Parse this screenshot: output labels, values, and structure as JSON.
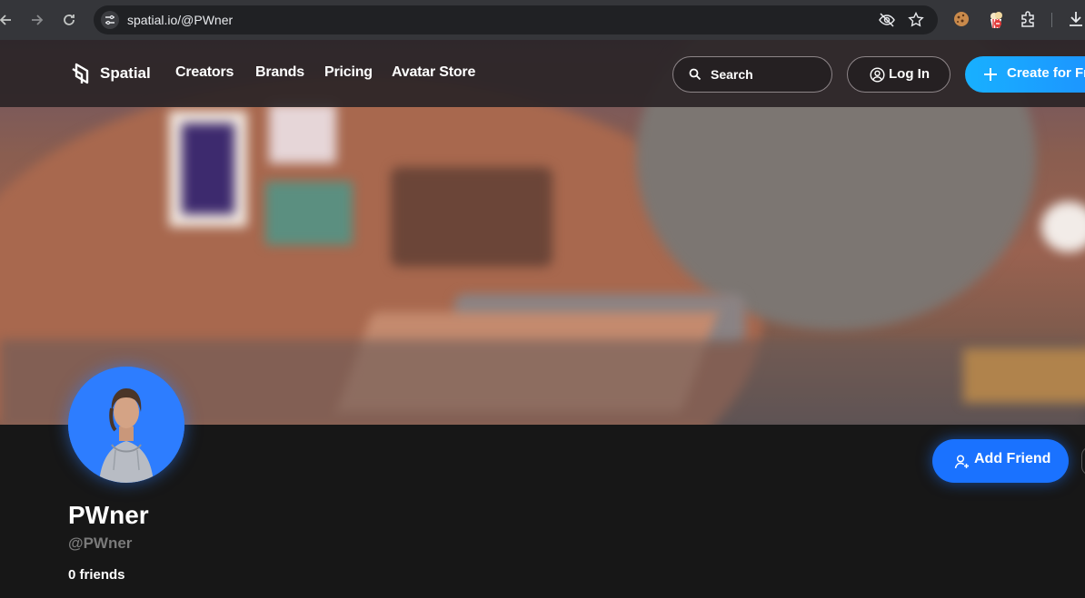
{
  "browser": {
    "url": "spatial.io/@PWner",
    "icons": [
      "back-icon",
      "forward-icon",
      "reload-icon",
      "site-info-icon",
      "eye-off-icon",
      "star-icon",
      "cookie-extension-icon",
      "popcorn-extension-icon",
      "extensions-icon",
      "download-icon"
    ]
  },
  "nav": {
    "logo_text": "Spatial",
    "links": [
      "Creators",
      "Brands",
      "Pricing",
      "Avatar Store"
    ],
    "search_label": "Search",
    "login_label": "Log In",
    "create_label": "Create for Free"
  },
  "profile": {
    "display_name": "PWner",
    "handle": "@PWner",
    "friends_count": "0",
    "friends_label": "friends",
    "add_friend_label": "Add Friend"
  },
  "colors": {
    "accent": "#1a72ff",
    "avatar_bg": "#2d7dff",
    "page_bg": "#171717"
  }
}
